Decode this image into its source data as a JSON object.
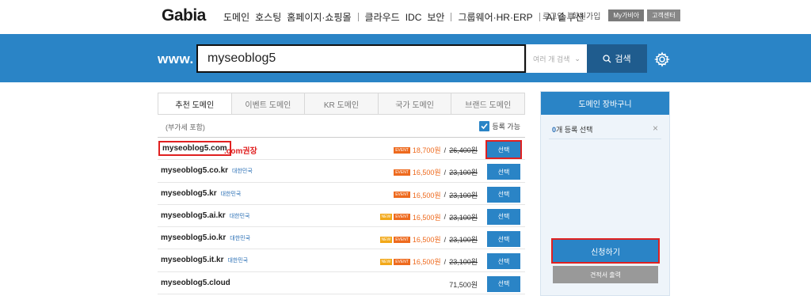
{
  "nav": {
    "logo": "Gabia",
    "menu": [
      {
        "label": "도메인",
        "sep": false
      },
      {
        "label": "호스팅",
        "sep": false
      },
      {
        "label": "홈페이지·쇼핑몰",
        "sep": true
      },
      {
        "label": "클라우드",
        "sep": false
      },
      {
        "label": "IDC",
        "sep": false
      },
      {
        "label": "보안",
        "sep": true
      },
      {
        "label": "그룹웨어·HR·ERP",
        "sep": true
      },
      {
        "label": "AI 솔루션",
        "sep": false
      }
    ],
    "util": {
      "login": "로그인",
      "signup": "회원가입",
      "mygabia": "My가비아",
      "support": "고객센터"
    }
  },
  "search": {
    "prefix": "www.",
    "value": "myseoblog5",
    "multi_label": "여러 개 검색",
    "button_label": "검색",
    "search_icon": "search-icon",
    "settings_icon": "gear-icon"
  },
  "tabs": [
    {
      "label": "추천 도메인",
      "active": true
    },
    {
      "label": "이벤트 도메인",
      "active": false
    },
    {
      "label": "KR 도메인",
      "active": false
    },
    {
      "label": "국가 도메인",
      "active": false
    },
    {
      "label": "브랜드 도메인",
      "active": false
    }
  ],
  "subhead": {
    "vat_note": "(부가세 포함)",
    "available_label": "등록 가능",
    "available_checked": true
  },
  "domains": [
    {
      "name": "myseoblog5.com",
      "region": "",
      "badges": [
        "EVENT"
      ],
      "sale": "18,700원",
      "orig": "26,400원",
      "button": "선택",
      "highlight": true,
      "recommend": ".com권장"
    },
    {
      "name": "myseoblog5.co.kr",
      "region": "대한민국",
      "badges": [
        "EVENT"
      ],
      "sale": "16,500원",
      "orig": "23,100원",
      "button": "선택",
      "highlight": false,
      "recommend": ""
    },
    {
      "name": "myseoblog5.kr",
      "region": "대한민국",
      "badges": [
        "EVENT"
      ],
      "sale": "16,500원",
      "orig": "23,100원",
      "button": "선택",
      "highlight": false,
      "recommend": ""
    },
    {
      "name": "myseoblog5.ai.kr",
      "region": "대한민국",
      "badges": [
        "NEW",
        "EVENT"
      ],
      "sale": "16,500원",
      "orig": "23,100원",
      "button": "선택",
      "highlight": false,
      "recommend": ""
    },
    {
      "name": "myseoblog5.io.kr",
      "region": "대한민국",
      "badges": [
        "NEW",
        "EVENT"
      ],
      "sale": "16,500원",
      "orig": "23,100원",
      "button": "선택",
      "highlight": false,
      "recommend": ""
    },
    {
      "name": "myseoblog5.it.kr",
      "region": "대한민국",
      "badges": [
        "NEW",
        "EVENT"
      ],
      "sale": "16,500원",
      "orig": "23,100원",
      "button": "선택",
      "highlight": false,
      "recommend": ""
    },
    {
      "name": "myseoblog5.cloud",
      "region": "",
      "badges": [],
      "sale": "",
      "orig": "",
      "regular": "71,500원",
      "button": "선택",
      "highlight": false,
      "recommend": ""
    }
  ],
  "cart": {
    "title": "도메인 장바구니",
    "count": "0",
    "count_suffix": "개 등록 선택",
    "close_icon": "close-icon",
    "apply_label": "신청하기",
    "quote_label": "견적서 출력"
  },
  "colors": {
    "brand_blue": "#2a84c6",
    "search_btn": "#1f5c8e",
    "event_orange": "#ee6a1e",
    "new_yellow": "#f2a818",
    "highlight_red": "#e02020"
  }
}
